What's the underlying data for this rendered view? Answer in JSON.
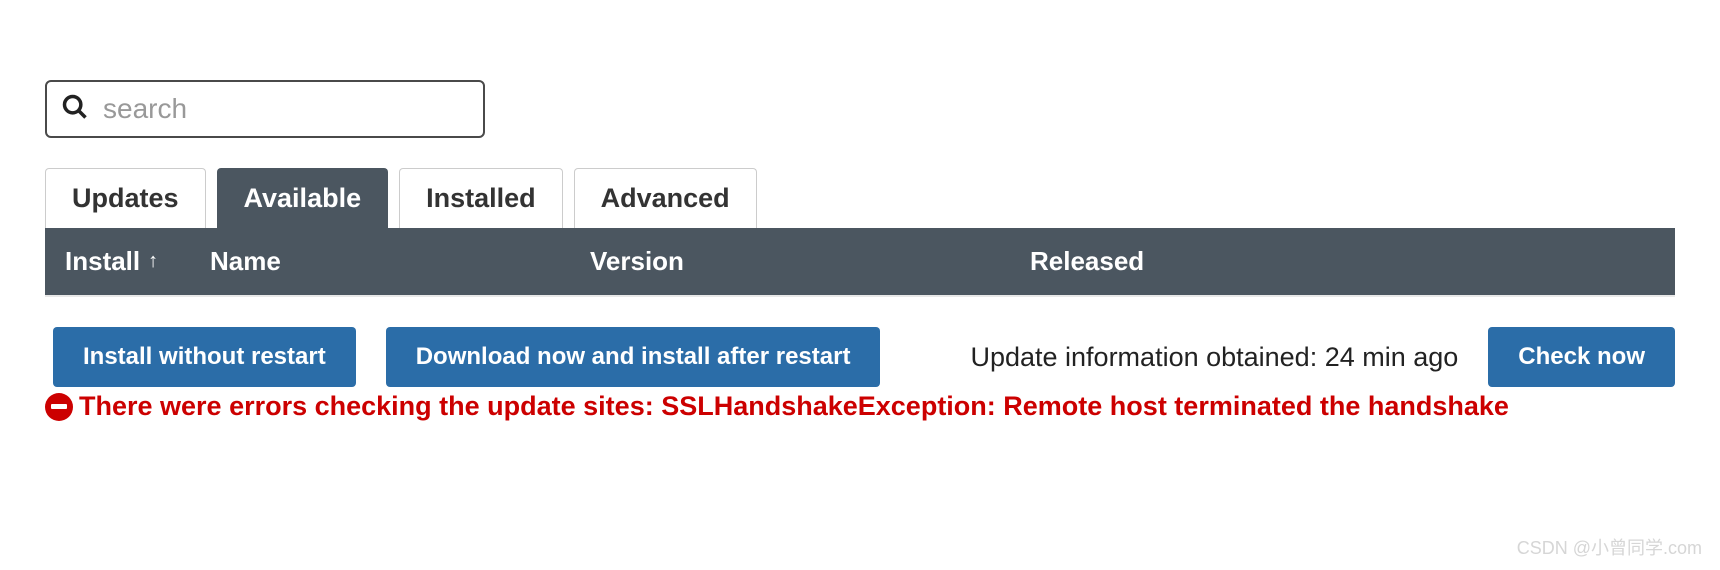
{
  "search": {
    "placeholder": "search",
    "value": ""
  },
  "tabs": [
    {
      "label": "Updates",
      "active": false
    },
    {
      "label": "Available",
      "active": true
    },
    {
      "label": "Installed",
      "active": false
    },
    {
      "label": "Advanced",
      "active": false
    }
  ],
  "columns": {
    "install": "Install",
    "sort_arrow": "↑",
    "name": "Name",
    "version": "Version",
    "released": "Released"
  },
  "buttons": {
    "install_without_restart": "Install without restart",
    "download_install_after_restart": "Download now and install after restart",
    "check_now": "Check now"
  },
  "status": {
    "update_info": "Update information obtained: 24 min ago"
  },
  "error": {
    "message": "There were errors checking the update sites: SSLHandshakeException: Remote host terminated the handshake"
  },
  "watermark": "CSDN @小曾同学.com"
}
